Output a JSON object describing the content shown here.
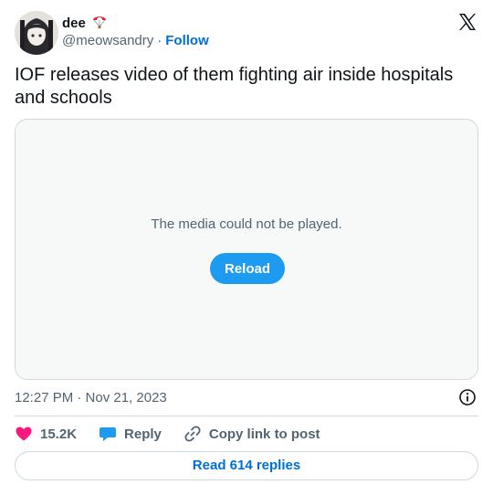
{
  "author": {
    "display_name": "dee",
    "handle": "@meowsandry",
    "separator": "·",
    "follow_label": "Follow"
  },
  "tweet": {
    "text": "IOF releases video of them fighting air inside hospitals and schools",
    "timestamp": "12:27 PM · Nov 21, 2023"
  },
  "media": {
    "message": "The media could not be played.",
    "reload_label": "Reload"
  },
  "actions": {
    "like_count": "15.2K",
    "reply_label": "Reply",
    "copy_label": "Copy link to post"
  },
  "footer": {
    "read_replies_label": "Read 614 replies"
  },
  "colors": {
    "accent": "#1d9bf0",
    "link": "#006fd6",
    "like": "#f91880",
    "muted": "#536471",
    "border": "#cfd9de"
  },
  "icons": {
    "logo": "x-logo-icon",
    "badge": "parachute-emoji-icon",
    "info": "info-icon",
    "like": "heart-icon",
    "reply": "speech-bubble-icon",
    "copy": "link-icon"
  }
}
